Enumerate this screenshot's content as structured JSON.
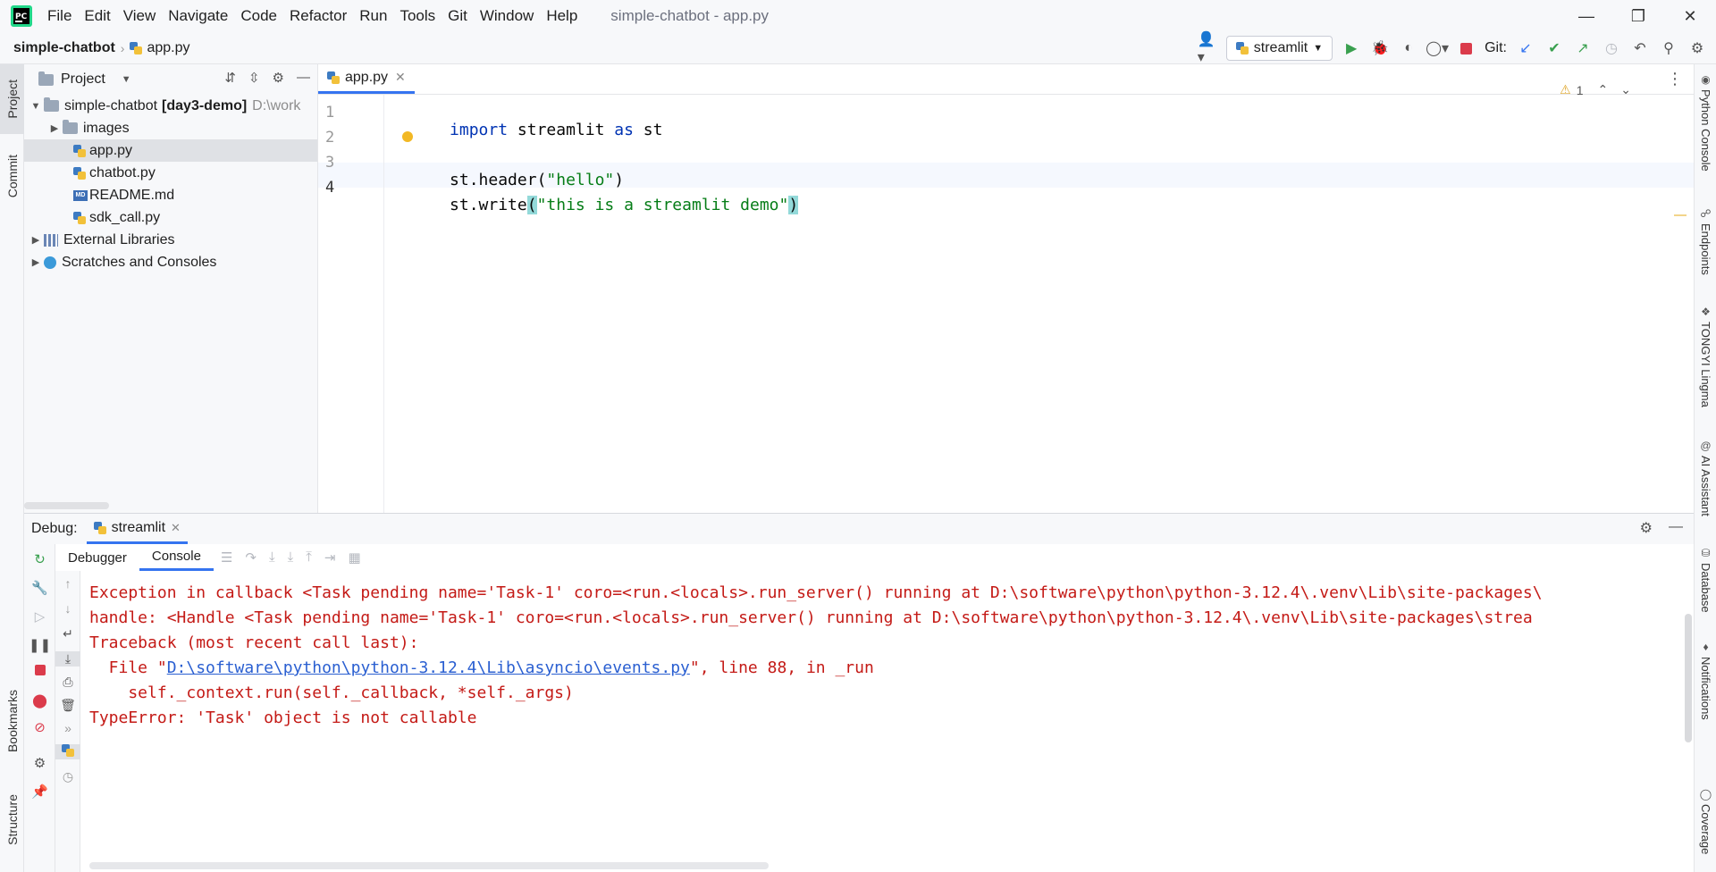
{
  "menu": {
    "items": [
      "File",
      "Edit",
      "View",
      "Navigate",
      "Code",
      "Refactor",
      "Run",
      "Tools",
      "Git",
      "Window",
      "Help"
    ],
    "window_title": "simple-chatbot - app.py"
  },
  "nav": {
    "project": "simple-chatbot",
    "file": "app.py",
    "run_config": "streamlit",
    "git_label": "Git:"
  },
  "left_stripe": {
    "project": "Project",
    "commit": "Commit",
    "bookmarks": "Bookmarks",
    "structure": "Structure"
  },
  "right_stripe": [
    "Python Console",
    "Endpoints",
    "TONGYI Lingma",
    "AI Assistant",
    "Database",
    "Notifications",
    "Coverage"
  ],
  "project_panel": {
    "title": "Project",
    "root": {
      "name": "simple-chatbot",
      "extra": "[day3-demo]",
      "path": "D:\\work"
    },
    "items": [
      {
        "label": "images",
        "type": "folder"
      },
      {
        "label": "app.py",
        "type": "py",
        "selected": true
      },
      {
        "label": "chatbot.py",
        "type": "py"
      },
      {
        "label": "README.md",
        "type": "md"
      },
      {
        "label": "sdk_call.py",
        "type": "py"
      }
    ],
    "ext_libs": "External Libraries",
    "scratches": "Scratches and Consoles"
  },
  "editor": {
    "tab": "app.py",
    "warnings": "1",
    "lines": [
      "1",
      "2",
      "3",
      "4"
    ],
    "code": {
      "l1_kw1": "import",
      "l1_mod": " streamlit ",
      "l1_kw2": "as",
      "l1_alias": " st",
      "l3_a": "st.header(",
      "l3_str": "\"hello\"",
      "l3_b": ")",
      "l4_a": "st.write",
      "l4_open": "(",
      "l4_str": "\"this is a streamlit demo\"",
      "l4_close": ")"
    }
  },
  "debug": {
    "label": "Debug:",
    "tab": "streamlit",
    "subtabs": [
      "Debugger",
      "Console"
    ],
    "console": {
      "l1": "Exception in callback <Task pending name='Task-1' coro=<run.<locals>.run_server() running at D:\\software\\python\\python-3.12.4\\.venv\\Lib\\site-packages\\",
      "l2": "handle: <Handle <Task pending name='Task-1' coro=<run.<locals>.run_server() running at D:\\software\\python\\python-3.12.4\\.venv\\Lib\\site-packages\\strea",
      "l3": "Traceback (most recent call last):",
      "l4_pre": "  File \"",
      "l4_link": "D:\\software\\python\\python-3.12.4\\Lib\\asyncio\\events.py",
      "l4_post": "\", line 88, in _run",
      "l5": "    self._context.run(self._callback, *self._args)",
      "l6": "TypeError: 'Task' object is not callable"
    }
  }
}
